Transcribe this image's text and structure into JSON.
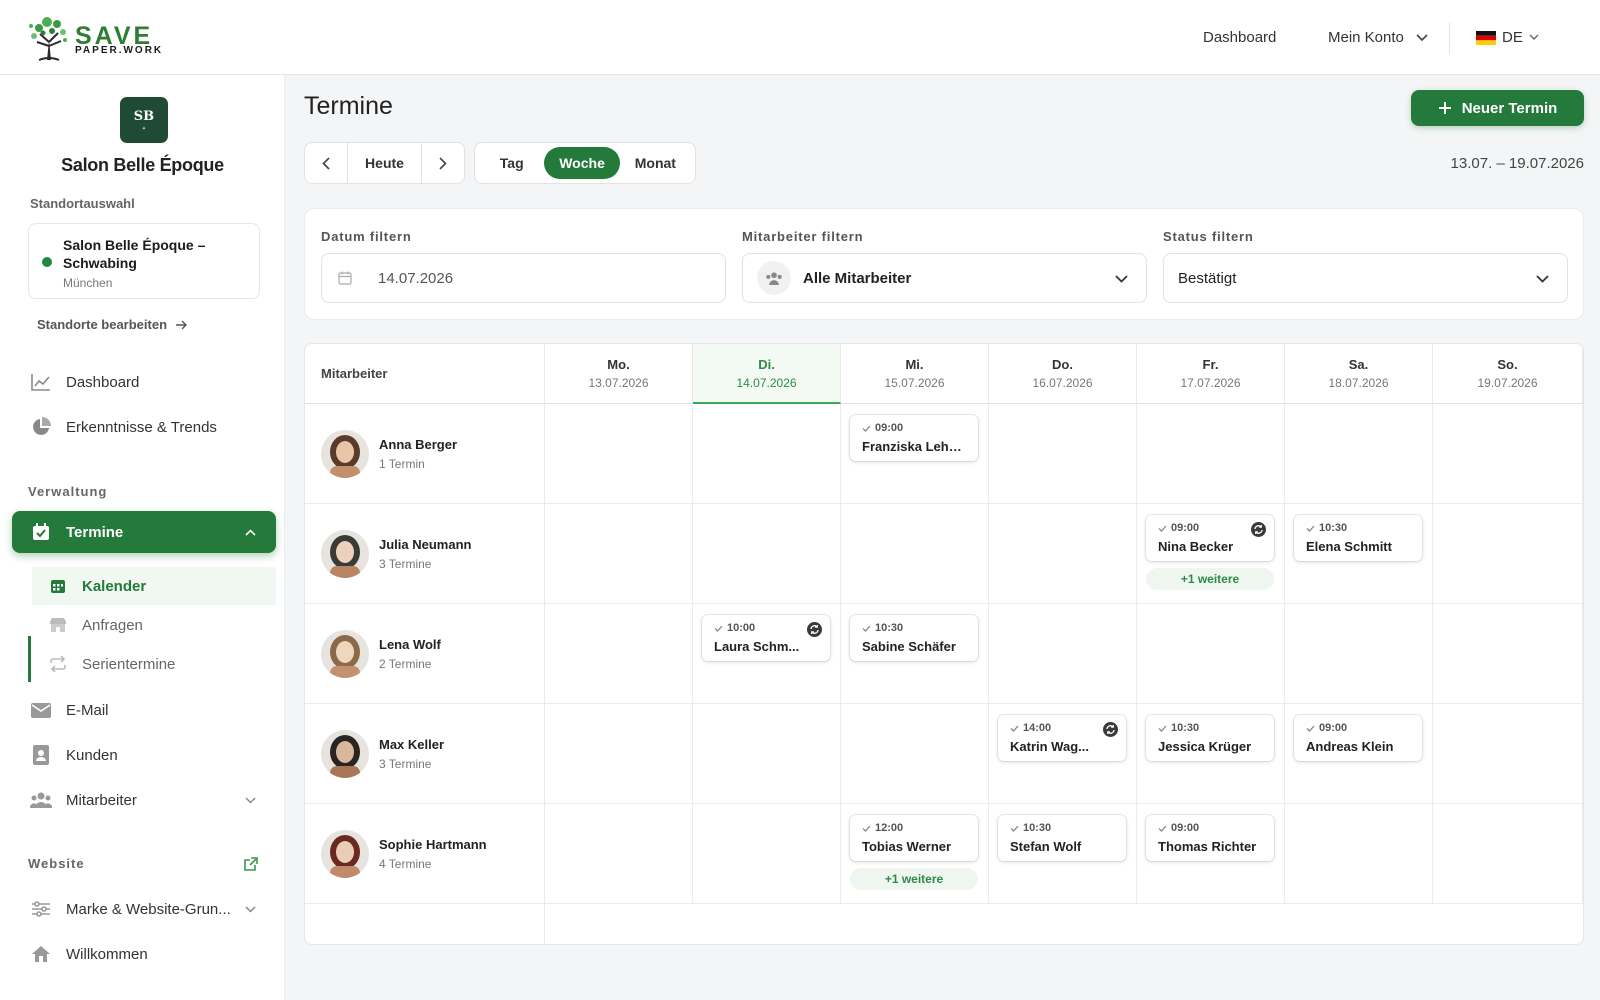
{
  "brand": {
    "title": "SAVE",
    "subtitle": "PAPER.WORK"
  },
  "topnav": {
    "dashboard": "Dashboard",
    "account": "Mein Konto",
    "lang": "DE"
  },
  "sidebar": {
    "logo_initials": "SB",
    "salon_name": "Salon Belle Époque",
    "location_label": "Standortauswahl",
    "location": {
      "title": "Salon Belle Époque – Schwabing",
      "city": "München"
    },
    "edit_locations": "Standorte bearbeiten",
    "nav_top": [
      {
        "label": "Dashboard",
        "icon": "chart-line-icon"
      },
      {
        "label": "Erkenntnisse & Trends",
        "icon": "pie-chart-icon"
      }
    ],
    "verwaltung_label": "Verwaltung",
    "termine": {
      "label": "Termine",
      "icon": "calendar-check-icon"
    },
    "termine_sub": [
      {
        "label": "Kalender",
        "icon": "calendar-icon",
        "active": true
      },
      {
        "label": "Anfragen",
        "icon": "store-icon"
      },
      {
        "label": "Serientermine",
        "icon": "repeat-icon"
      }
    ],
    "nav_mid": [
      {
        "label": "E-Mail",
        "icon": "mail-icon"
      },
      {
        "label": "Kunden",
        "icon": "contact-book-icon"
      },
      {
        "label": "Mitarbeiter",
        "icon": "users-icon"
      }
    ],
    "website_label": "Website",
    "nav_bottom": [
      {
        "label": "Marke & Website-Grun...",
        "icon": "sliders-icon"
      },
      {
        "label": "Willkommen",
        "icon": "home-icon"
      }
    ]
  },
  "main": {
    "title": "Termine",
    "new_button": "Neuer Termin",
    "today": "Heute",
    "views": [
      "Tag",
      "Woche",
      "Monat"
    ],
    "selected_view": "Woche",
    "date_range": "13.07. – 19.07.2026"
  },
  "filters": {
    "date": {
      "label": "Datum filtern",
      "value": "14.07.2026"
    },
    "employee": {
      "label": "Mitarbeiter filtern",
      "value": "Alle Mitarbeiter"
    },
    "status": {
      "label": "Status filtern",
      "value": "Bestätigt"
    }
  },
  "calendar": {
    "employee_header": "Mitarbeiter",
    "days": [
      {
        "day": "Mo.",
        "date": "13.07.2026"
      },
      {
        "day": "Di.",
        "date": "14.07.2026",
        "today": true
      },
      {
        "day": "Mi.",
        "date": "15.07.2026"
      },
      {
        "day": "Do.",
        "date": "16.07.2026"
      },
      {
        "day": "Fr.",
        "date": "17.07.2026"
      },
      {
        "day": "Sa.",
        "date": "18.07.2026"
      },
      {
        "day": "So.",
        "date": "19.07.2026"
      }
    ],
    "employees": [
      {
        "name": "Anna Berger",
        "count": "1 Termin",
        "appointments": [
          {
            "day": 2,
            "time": "09:00",
            "client": "Franziska Lehm..."
          }
        ]
      },
      {
        "name": "Julia Neumann",
        "count": "3 Termine",
        "appointments": [
          {
            "day": 4,
            "time": "09:00",
            "client": "Nina Becker",
            "recurring": true,
            "more": "+1 weitere"
          },
          {
            "day": 5,
            "time": "10:30",
            "client": "Elena Schmitt"
          }
        ]
      },
      {
        "name": "Lena Wolf",
        "count": "2 Termine",
        "appointments": [
          {
            "day": 1,
            "time": "10:00",
            "client": "Laura Schm...",
            "recurring": true
          },
          {
            "day": 2,
            "time": "10:30",
            "client": "Sabine Schäfer"
          }
        ]
      },
      {
        "name": "Max Keller",
        "count": "3 Termine",
        "appointments": [
          {
            "day": 3,
            "time": "14:00",
            "client": "Katrin Wag...",
            "recurring": true
          },
          {
            "day": 4,
            "time": "10:30",
            "client": "Jessica Krüger"
          },
          {
            "day": 5,
            "time": "09:00",
            "client": "Andreas Klein"
          }
        ]
      },
      {
        "name": "Sophie Hartmann",
        "count": "4 Termine",
        "appointments": [
          {
            "day": 2,
            "time": "12:00",
            "client": "Tobias Werner",
            "more": "+1 weitere"
          },
          {
            "day": 3,
            "time": "10:30",
            "client": "Stefan Wolf"
          },
          {
            "day": 4,
            "time": "09:00",
            "client": "Thomas Richter"
          }
        ]
      }
    ]
  },
  "colors": {
    "accent": "#237a3a",
    "today_highlight": "#3fa75a",
    "sidebar_logo": "#1f4a33"
  }
}
